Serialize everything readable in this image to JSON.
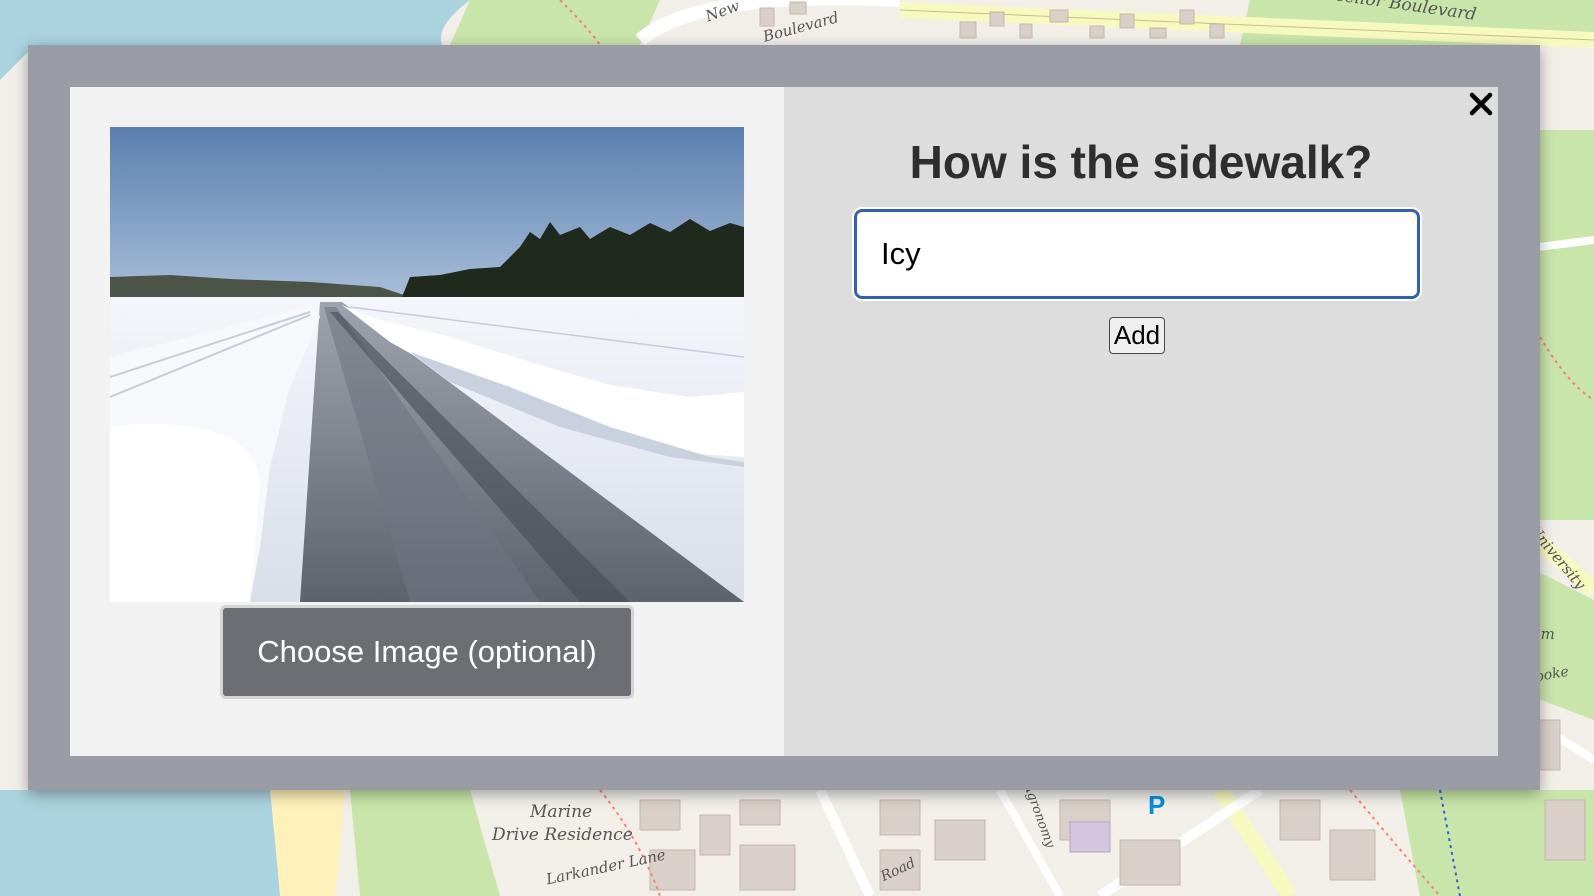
{
  "map": {
    "street_labels": [
      "New",
      "Boulevard",
      "Chancellor Boulevard",
      "Marine",
      "Drive Residence",
      "Larkander Lane",
      "University",
      "Agronomy",
      "Road",
      "elam",
      "Crooke"
    ],
    "parking_symbol": "P"
  },
  "modal": {
    "question": "How is the sidewalk?",
    "answer_value": "Icy",
    "add_label": "Add",
    "choose_image_label": "Choose Image (optional)",
    "close_icon": "close-icon"
  },
  "colors": {
    "frame": "#9a9ca3",
    "left_panel": "#f2f2f2",
    "right_panel": "#dddddd",
    "choose_button": "#6c6e73",
    "input_focus_border": "#2f5fbf"
  }
}
